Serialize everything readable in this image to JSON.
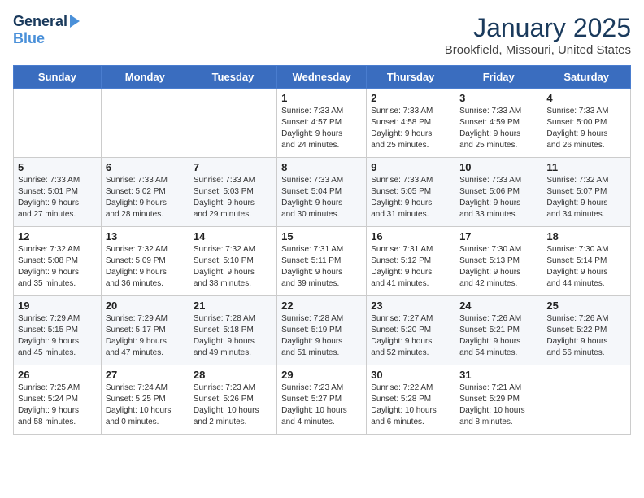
{
  "app": {
    "logo_general": "General",
    "logo_blue": "Blue"
  },
  "header": {
    "month": "January 2025",
    "location": "Brookfield, Missouri, United States"
  },
  "weekdays": [
    "Sunday",
    "Monday",
    "Tuesday",
    "Wednesday",
    "Thursday",
    "Friday",
    "Saturday"
  ],
  "weeks": [
    [
      {
        "day": "",
        "info": ""
      },
      {
        "day": "",
        "info": ""
      },
      {
        "day": "",
        "info": ""
      },
      {
        "day": "1",
        "info": "Sunrise: 7:33 AM\nSunset: 4:57 PM\nDaylight: 9 hours\nand 24 minutes."
      },
      {
        "day": "2",
        "info": "Sunrise: 7:33 AM\nSunset: 4:58 PM\nDaylight: 9 hours\nand 25 minutes."
      },
      {
        "day": "3",
        "info": "Sunrise: 7:33 AM\nSunset: 4:59 PM\nDaylight: 9 hours\nand 25 minutes."
      },
      {
        "day": "4",
        "info": "Sunrise: 7:33 AM\nSunset: 5:00 PM\nDaylight: 9 hours\nand 26 minutes."
      }
    ],
    [
      {
        "day": "5",
        "info": "Sunrise: 7:33 AM\nSunset: 5:01 PM\nDaylight: 9 hours\nand 27 minutes."
      },
      {
        "day": "6",
        "info": "Sunrise: 7:33 AM\nSunset: 5:02 PM\nDaylight: 9 hours\nand 28 minutes."
      },
      {
        "day": "7",
        "info": "Sunrise: 7:33 AM\nSunset: 5:03 PM\nDaylight: 9 hours\nand 29 minutes."
      },
      {
        "day": "8",
        "info": "Sunrise: 7:33 AM\nSunset: 5:04 PM\nDaylight: 9 hours\nand 30 minutes."
      },
      {
        "day": "9",
        "info": "Sunrise: 7:33 AM\nSunset: 5:05 PM\nDaylight: 9 hours\nand 31 minutes."
      },
      {
        "day": "10",
        "info": "Sunrise: 7:33 AM\nSunset: 5:06 PM\nDaylight: 9 hours\nand 33 minutes."
      },
      {
        "day": "11",
        "info": "Sunrise: 7:32 AM\nSunset: 5:07 PM\nDaylight: 9 hours\nand 34 minutes."
      }
    ],
    [
      {
        "day": "12",
        "info": "Sunrise: 7:32 AM\nSunset: 5:08 PM\nDaylight: 9 hours\nand 35 minutes."
      },
      {
        "day": "13",
        "info": "Sunrise: 7:32 AM\nSunset: 5:09 PM\nDaylight: 9 hours\nand 36 minutes."
      },
      {
        "day": "14",
        "info": "Sunrise: 7:32 AM\nSunset: 5:10 PM\nDaylight: 9 hours\nand 38 minutes."
      },
      {
        "day": "15",
        "info": "Sunrise: 7:31 AM\nSunset: 5:11 PM\nDaylight: 9 hours\nand 39 minutes."
      },
      {
        "day": "16",
        "info": "Sunrise: 7:31 AM\nSunset: 5:12 PM\nDaylight: 9 hours\nand 41 minutes."
      },
      {
        "day": "17",
        "info": "Sunrise: 7:30 AM\nSunset: 5:13 PM\nDaylight: 9 hours\nand 42 minutes."
      },
      {
        "day": "18",
        "info": "Sunrise: 7:30 AM\nSunset: 5:14 PM\nDaylight: 9 hours\nand 44 minutes."
      }
    ],
    [
      {
        "day": "19",
        "info": "Sunrise: 7:29 AM\nSunset: 5:15 PM\nDaylight: 9 hours\nand 45 minutes."
      },
      {
        "day": "20",
        "info": "Sunrise: 7:29 AM\nSunset: 5:17 PM\nDaylight: 9 hours\nand 47 minutes."
      },
      {
        "day": "21",
        "info": "Sunrise: 7:28 AM\nSunset: 5:18 PM\nDaylight: 9 hours\nand 49 minutes."
      },
      {
        "day": "22",
        "info": "Sunrise: 7:28 AM\nSunset: 5:19 PM\nDaylight: 9 hours\nand 51 minutes."
      },
      {
        "day": "23",
        "info": "Sunrise: 7:27 AM\nSunset: 5:20 PM\nDaylight: 9 hours\nand 52 minutes."
      },
      {
        "day": "24",
        "info": "Sunrise: 7:26 AM\nSunset: 5:21 PM\nDaylight: 9 hours\nand 54 minutes."
      },
      {
        "day": "25",
        "info": "Sunrise: 7:26 AM\nSunset: 5:22 PM\nDaylight: 9 hours\nand 56 minutes."
      }
    ],
    [
      {
        "day": "26",
        "info": "Sunrise: 7:25 AM\nSunset: 5:24 PM\nDaylight: 9 hours\nand 58 minutes."
      },
      {
        "day": "27",
        "info": "Sunrise: 7:24 AM\nSunset: 5:25 PM\nDaylight: 10 hours\nand 0 minutes."
      },
      {
        "day": "28",
        "info": "Sunrise: 7:23 AM\nSunset: 5:26 PM\nDaylight: 10 hours\nand 2 minutes."
      },
      {
        "day": "29",
        "info": "Sunrise: 7:23 AM\nSunset: 5:27 PM\nDaylight: 10 hours\nand 4 minutes."
      },
      {
        "day": "30",
        "info": "Sunrise: 7:22 AM\nSunset: 5:28 PM\nDaylight: 10 hours\nand 6 minutes."
      },
      {
        "day": "31",
        "info": "Sunrise: 7:21 AM\nSunset: 5:29 PM\nDaylight: 10 hours\nand 8 minutes."
      },
      {
        "day": "",
        "info": ""
      }
    ]
  ]
}
